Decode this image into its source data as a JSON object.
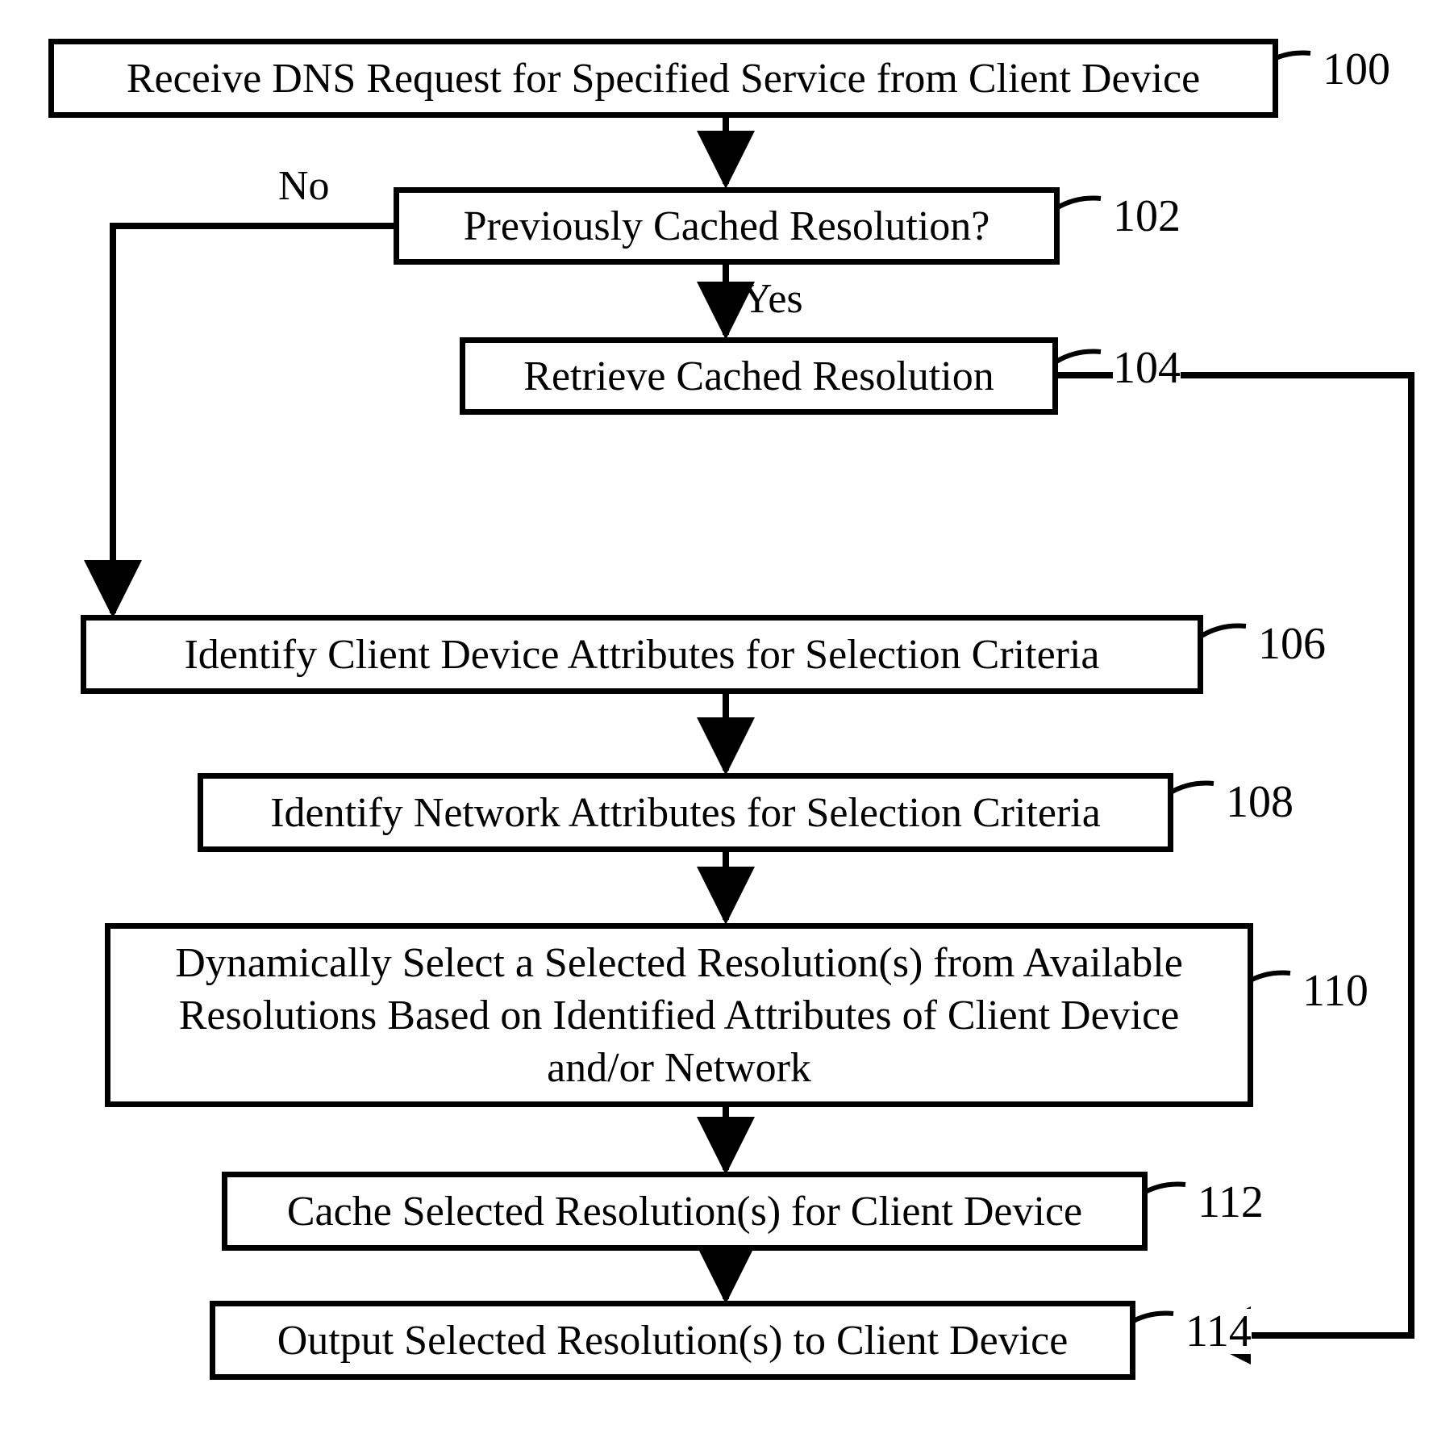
{
  "nodes": {
    "n100": {
      "text": "Receive DNS Request for Specified Service from Client Device",
      "ref": "100"
    },
    "n102": {
      "text": "Previously Cached Resolution?",
      "ref": "102"
    },
    "n104": {
      "text": "Retrieve Cached Resolution",
      "ref": "104"
    },
    "n106": {
      "text": "Identify Client Device Attributes for Selection Criteria",
      "ref": "106"
    },
    "n108": {
      "text": "Identify Network Attributes for Selection Criteria",
      "ref": "108"
    },
    "n110": {
      "text": "Dynamically Select a Selected Resolution(s) from Available Resolutions Based on Identified Attributes of Client Device and/or Network",
      "ref": "110"
    },
    "n112": {
      "text": "Cache Selected Resolution(s) for Client Device",
      "ref": "112"
    },
    "n114": {
      "text": "Output Selected Resolution(s) to Client Device",
      "ref": "114"
    }
  },
  "edges": {
    "no": "No",
    "yes": "Yes"
  }
}
